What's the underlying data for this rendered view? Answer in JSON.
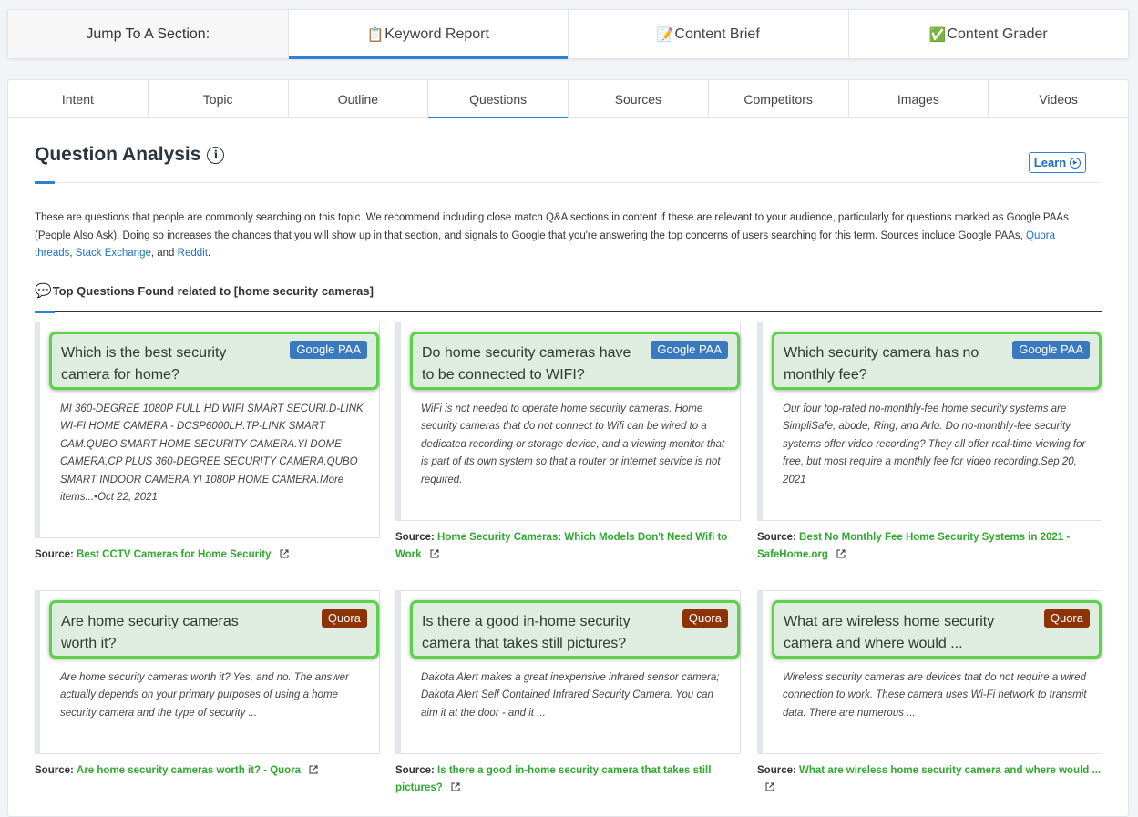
{
  "jump": {
    "label": "Jump To A Section:",
    "items": [
      {
        "icon": "📋",
        "icon_name": "clipboard-icon",
        "label": "Keyword Report",
        "active": true
      },
      {
        "icon": "📝",
        "icon_name": "memo-icon",
        "label": "Content Brief",
        "active": false
      },
      {
        "icon": "✅",
        "icon_name": "check-icon",
        "label": "Content Grader",
        "active": false
      }
    ]
  },
  "tabs": [
    "Intent",
    "Topic",
    "Outline",
    "Questions",
    "Sources",
    "Competitors",
    "Images",
    "Videos"
  ],
  "active_tab": "Questions",
  "section": {
    "title": "Question Analysis",
    "learn_label": "Learn",
    "description_parts": {
      "p1": "These are questions that people are commonly searching on this topic. We recommend including close match Q&A sections in content if these are relevant to your audience, particularly for questions marked as Google PAAs (People Also Ask). Doing so increases the chances that you will show up in that section, and signals to Google that you're answering the top concerns of users searching for this term. Sources include Google PAAs, ",
      "link1": "Quora threads",
      "sep1": ", ",
      "link2": "Stack Exchange",
      "sep2": ", and ",
      "link3": "Reddit",
      "end": "."
    },
    "subheading_icon": "💬",
    "subheading": "Top Questions Found related to [home security cameras]"
  },
  "source_label": "Source:",
  "cards": [
    {
      "question": "Which is the best security camera for home?",
      "badge": "Google PAA",
      "badge_type": "paa",
      "answer": "MI 360-DEGREE 1080P FULL HD WIFI SMART SECURI.D-LINK WI-FI HOME CAMERA - DCSP6000LH.TP-LINK SMART CAM.QUBO SMART HOME SECURITY CAMERA.YI DOME CAMERA.CP PLUS 360-DEGREE SECURITY CAMERA.QUBO SMART INDOOR CAMERA.YI 1080P HOME CAMERA.More items...•Oct 22, 2021",
      "source": "Best CCTV Cameras for Home Security"
    },
    {
      "question": "Do home security cameras have to be connected to WIFI?",
      "badge": "Google PAA",
      "badge_type": "paa",
      "answer": "WiFi is not needed to operate home security cameras. Home security cameras that do not connect to Wifi can be wired to a dedicated recording or storage device, and a viewing monitor that is part of its own system so that a router or internet service is not required.",
      "source": "Home Security Cameras: Which Models Don't Need Wifi to Work"
    },
    {
      "question": "Which security camera has no monthly fee?",
      "badge": "Google PAA",
      "badge_type": "paa",
      "answer": "Our four top-rated no-monthly-fee home security systems are SimpliSafe, abode, Ring, and Arlo. Do no-monthly-fee security systems offer video recording? They all offer real-time viewing for free, but most require a monthly fee for video recording.Sep 20, 2021",
      "source": "Best No Monthly Fee Home Security Systems in 2021 - SafeHome.org"
    },
    {
      "question": "Are home security cameras worth it?",
      "badge": "Quora",
      "badge_type": "quora",
      "answer": "Are home security cameras worth it? Yes, and no. The answer actually depends on your primary purposes of using a home security camera and the type of security ...",
      "source": "Are home security cameras worth it? - Quora"
    },
    {
      "question": "Is there a good in-home security camera that takes still pictures?",
      "badge": "Quora",
      "badge_type": "quora",
      "answer": "Dakota Alert makes a great inexpensive infrared sensor camera; Dakota Alert Self Contained Infrared Security Camera. You can aim it at the door - and it ...",
      "source": "Is there a good in-home security camera that takes still pictures?"
    },
    {
      "question": "What are wireless home security camera and where would ...",
      "badge": "Quora",
      "badge_type": "quora",
      "answer": "Wireless security cameras are devices that do not require a wired connection to work. These camera uses Wi-Fi network to transmit data. There are numerous ...",
      "source": "What are wireless home security camera and where would ..."
    }
  ]
}
